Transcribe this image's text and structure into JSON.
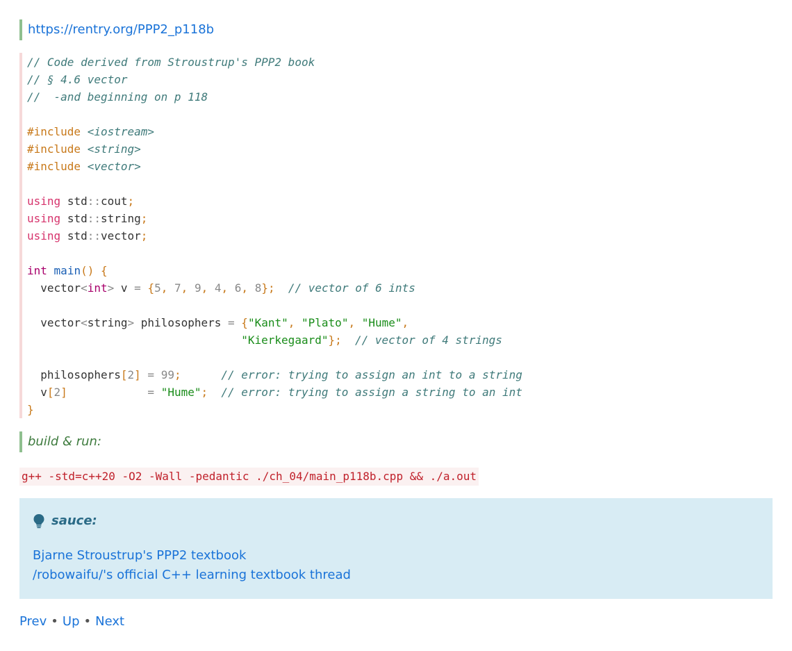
{
  "top_link": "https://rentry.org/PPP2_p118b",
  "code_lines": {
    "c1": "// Code derived from Stroustrup's PPP2 book",
    "c2": "// § 4.6 vector",
    "c3": "//  -and beginning on p 118",
    "include_kw": "#include",
    "inc1": "<iostream>",
    "inc2": "<string>",
    "inc3": "<vector>",
    "using_kw": "using",
    "std": "std",
    "cout": "cout",
    "string": "string",
    "vector": "vector",
    "int_kw": "int",
    "main": "main",
    "v_var": "v",
    "philosophers_var": "philosophers",
    "n5": "5",
    "n7": "7",
    "n9": "9",
    "n4": "4",
    "n6": "6",
    "n8": "8",
    "n2": "2",
    "n99": "99",
    "comment_ints": "// vector of 6 ints",
    "s_kant": "\"Kant\"",
    "s_plato": "\"Plato\"",
    "s_hume": "\"Hume\"",
    "s_kierkegaard": "\"Kierkegaard\"",
    "comment_strings": "// vector of 4 strings",
    "comment_err1": "// error: trying to assign an int to a string",
    "comment_err2": "// error: trying to assign a string to an int"
  },
  "build_label": "build & run:",
  "build_command": "g++ -std=c++20 -O2 -Wall -pedantic ./ch_04/main_p118b.cpp && ./a.out",
  "note": {
    "icon": "lightbulb-icon",
    "title": "sauce:",
    "links": [
      "Bjarne Stroustrup's PPP2 textbook",
      "/robowaifu/'s official C++ learning textbook thread"
    ]
  },
  "nav": {
    "prev": "Prev",
    "up": "Up",
    "next": "Next",
    "separator": "•"
  },
  "colors": {
    "link": "#1a73d8",
    "quote_border": "#8fbf8f",
    "note_bg": "#d8ecf4",
    "command_text": "#c0212b"
  }
}
